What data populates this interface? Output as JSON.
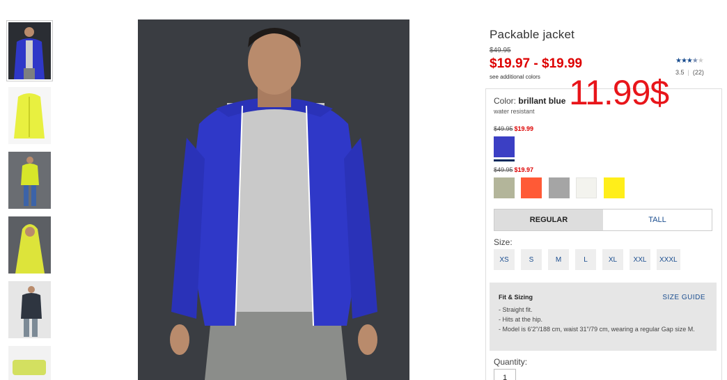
{
  "product": {
    "title": "Packable jacket",
    "original_price": "$49.95",
    "price_range": "$19.97 - $19.99",
    "additional_colors_link": "see additional colors",
    "rating": "3.5",
    "rating_count": "(22)",
    "stars_filled": "★★★",
    "stars_half": "★",
    "stars_empty": "★",
    "rating_value": 3.5,
    "overlay_price": "11.99$"
  },
  "color": {
    "label": "Color:",
    "name": "brillant blue",
    "note": "water resistant",
    "groups": [
      {
        "orig": "$49.95",
        "sale": "$19.99",
        "swatches": [
          "#3b3fc4"
        ]
      },
      {
        "orig": "$49.95",
        "sale": "$19.97",
        "swatches": [
          "#b3b59a",
          "#ff5a36",
          "#a5a5a5",
          "#f3f3ee",
          "#ffee1a"
        ]
      }
    ],
    "selected_swatch": "#3b3fc4"
  },
  "fit_tabs": [
    {
      "label": "REGULAR",
      "active": true
    },
    {
      "label": "TALL",
      "active": false
    }
  ],
  "size": {
    "label": "Size:",
    "options": [
      "XS",
      "S",
      "M",
      "L",
      "XL",
      "XXL",
      "XXXL"
    ]
  },
  "fit_sizing": {
    "heading": "Fit & Sizing",
    "guide_link": "SIZE GUIDE",
    "bullets": [
      "- Straight fit.",
      "- Hits at the hip.",
      "- Model is 6'2\"/188 cm, waist 31\"/79 cm, wearing a regular Gap size M."
    ]
  },
  "quantity": {
    "label": "Quantity:",
    "value": "1"
  },
  "thumbnails": [
    {
      "name": "thumb-blue-jacket-model",
      "bg": "#2a2d33",
      "color": "#2f38c8"
    },
    {
      "name": "thumb-yellow-jacket-flat",
      "bg": "#f6f6f6",
      "color": "#e8f040"
    },
    {
      "name": "thumb-yellow-jacket-model",
      "bg": "#6a6d72",
      "color": "#d7e62a"
    },
    {
      "name": "thumb-yellow-jacket-hood",
      "bg": "#5c5f64",
      "color": "#dde43a"
    },
    {
      "name": "thumb-dark-jacket-model",
      "bg": "#e6e6e6",
      "color": "#2e3540"
    },
    {
      "name": "thumb-yellow-jacket-packed",
      "bg": "#f2f2f2",
      "color": "#d3e060"
    }
  ],
  "colors": {
    "sale_red": "#d00",
    "link_blue": "#1a4d8f",
    "overlay_red": "#e8151a"
  }
}
